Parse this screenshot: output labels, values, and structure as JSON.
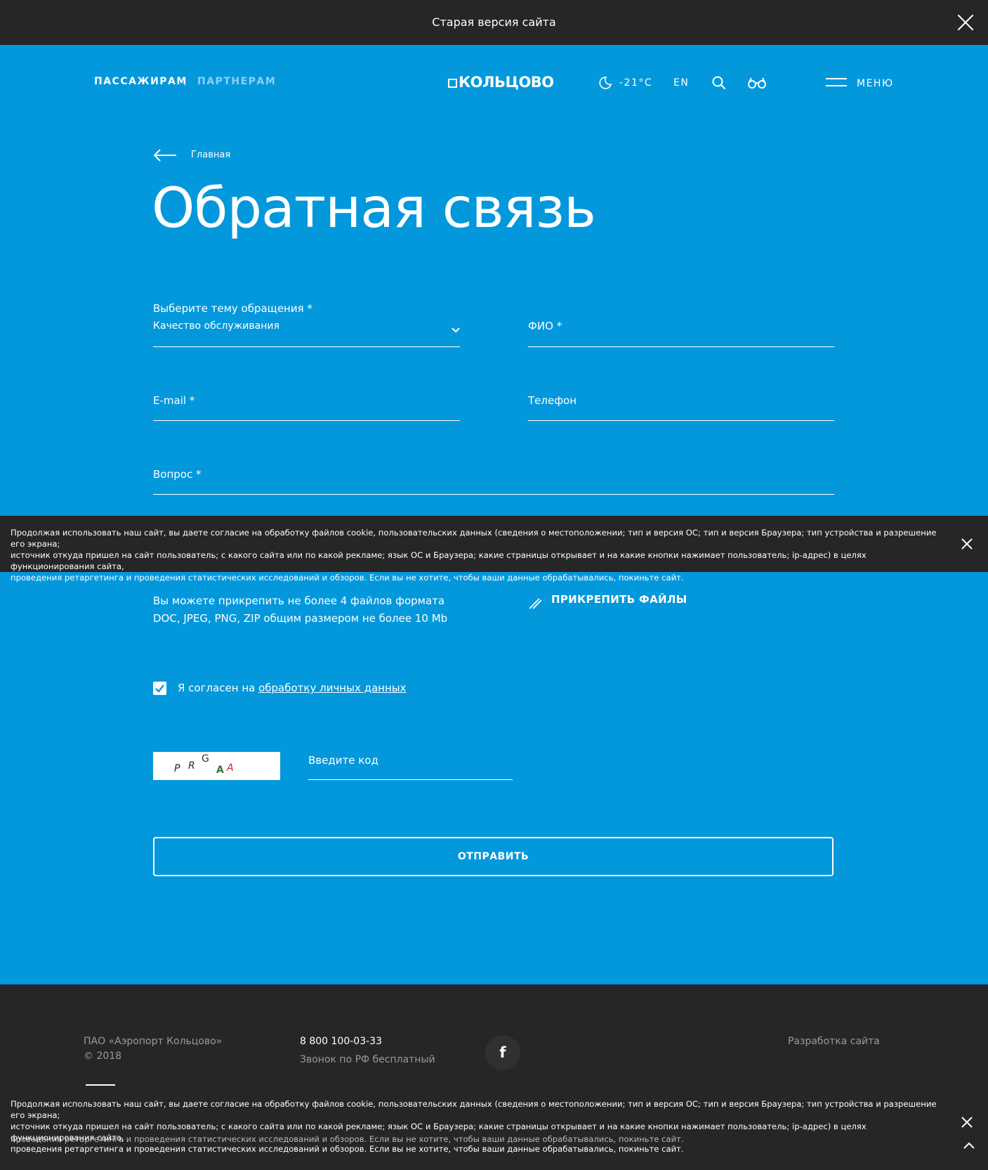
{
  "topbar": {
    "text": "Старая версия сайта"
  },
  "header": {
    "nav_passengers": "ПАССАЖИРАМ",
    "nav_partners": "ПАРТНЕРАМ",
    "logo": "КОЛЬЦОВО",
    "temperature": "-21°C",
    "lang": "EN",
    "menu_label": "МЕНЮ"
  },
  "breadcrumb": {
    "back_label": "Главная"
  },
  "page_title": "Обратная связь",
  "form": {
    "topic_label": "Выберите тему обращения *",
    "topic_value": "Качество обслуживания",
    "name_label": "ФИО *",
    "email_label": "E-mail *",
    "phone_label": "Телефон",
    "question_label": "Вопрос *",
    "attach_info_line1": "Вы можете прикрепить не более 4 файлов формата",
    "attach_info_line2": "DOC, JPEG, PNG, ZIP общим размером не более 10 Mb",
    "attach_button": "ПРИКРЕПИТЬ ФАЙЛЫ",
    "consent_prefix": "Я согласен на ",
    "consent_link": "обработку личных данных",
    "consent_checked": true,
    "captcha_chars": [
      "P",
      "R",
      "G",
      "A",
      "A"
    ],
    "captcha_label": "Введите код",
    "submit_label": "ОТПРАВИТЬ"
  },
  "cookie_banner": {
    "line1": "Продолжая использовать наш сайт, вы даете согласие на обработку файлов cookie, пользовательских данных (сведения о местоположении; тип и версия ОС; тип и версия Браузера; тип устройства и разрешение его экрана;",
    "line2": "источник откуда пришел на сайт пользователь; с какого сайта или по какой рекламе; язык ОС и Браузера; какие страницы открывает и на какие кнопки нажимает пользователь; ip-адрес) в целях функционирования сайта,",
    "line3": "проведения ретаргетинга и проведения статистических исследований и обзоров. Если вы не хотите, чтобы ваши данные обрабатывались, покиньте сайт."
  },
  "footer": {
    "company": "ПАО «Аэропорт Кольцово»",
    "copyright": "© 2018",
    "phone": "8 800 100-03-33",
    "phone_note": "Звонок по РФ бесплатный",
    "facebook": "f",
    "dev_link": "Разработка сайта"
  },
  "colors": {
    "background": "#0398dc",
    "dark": "#262626",
    "accent_light": "#8fd0f1"
  },
  "icons": [
    "close-icon",
    "moon-icon",
    "search-icon",
    "glasses-icon",
    "menu-icon",
    "arrow-left-icon",
    "chevron-down-icon",
    "paperclip-icon",
    "check-icon",
    "facebook-icon",
    "chevron-up-icon"
  ]
}
